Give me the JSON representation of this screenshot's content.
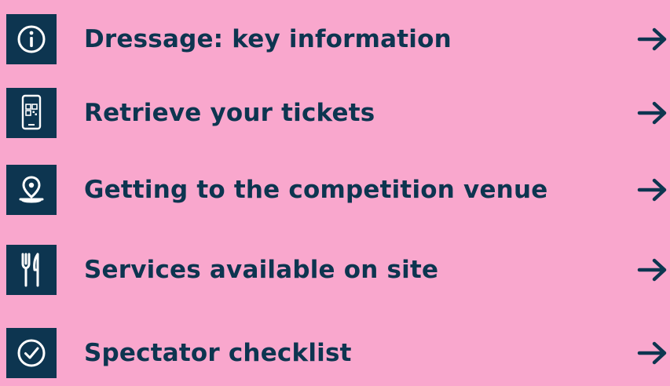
{
  "theme": {
    "background": "#f9a7cd",
    "accent": "#0d3550"
  },
  "items": [
    {
      "label": "Dressage: key information",
      "icon": "info-icon"
    },
    {
      "label": "Retrieve your tickets",
      "icon": "smartphone-qr-icon"
    },
    {
      "label": "Getting to the competition venue",
      "icon": "location-pin-icon"
    },
    {
      "label": "Services available on site",
      "icon": "fork-knife-icon"
    },
    {
      "label": "Spectator checklist",
      "icon": "check-circle-icon"
    }
  ]
}
